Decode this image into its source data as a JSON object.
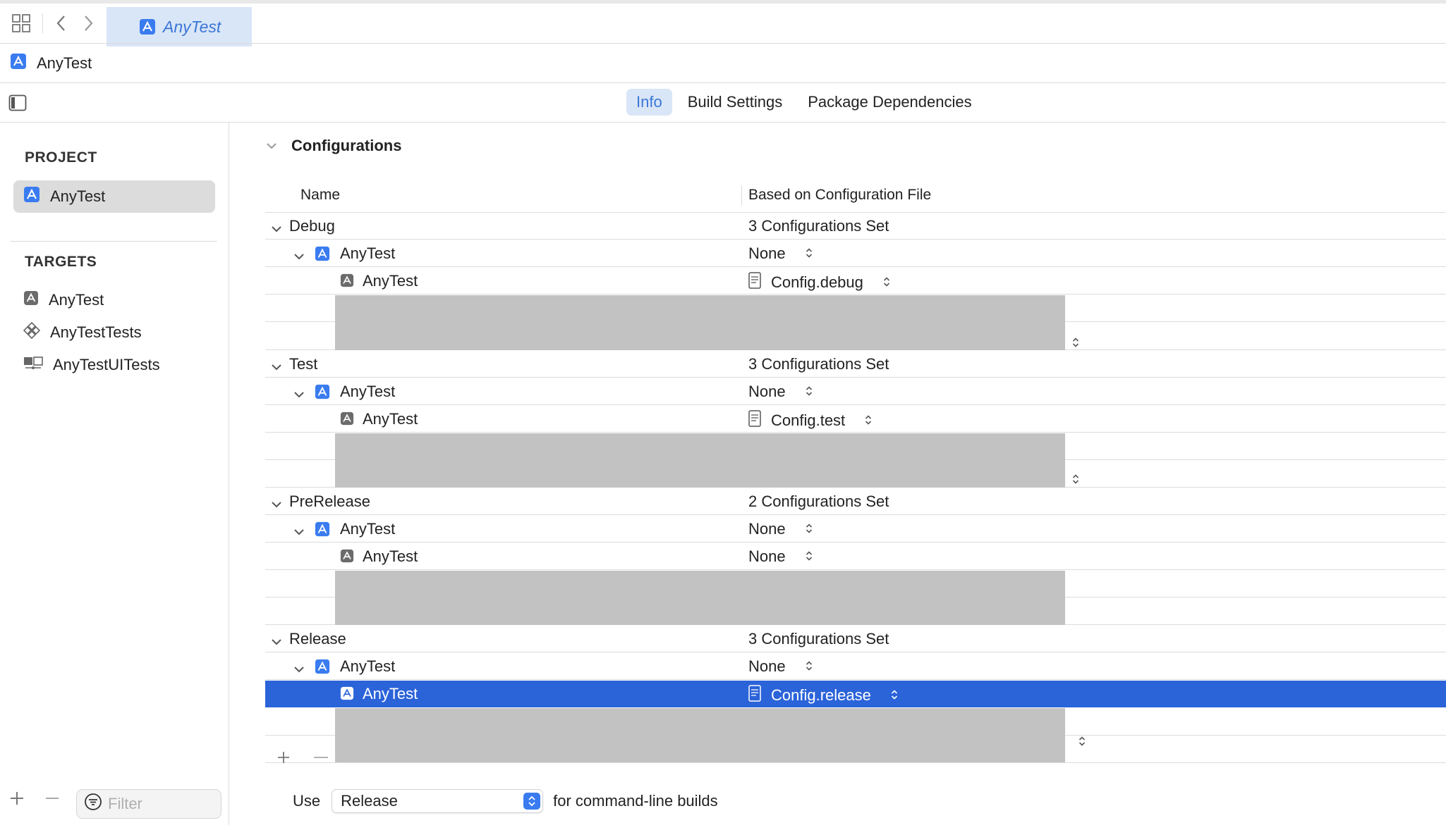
{
  "tab_bar": {
    "file_tab_label": "AnyTest",
    "icons": [
      "grid-icon",
      "back-chevron-icon",
      "forward-chevron-icon",
      "app-icon"
    ]
  },
  "jump_bar": {
    "project_label": "AnyTest"
  },
  "editor_tabs": {
    "items": [
      "Info",
      "Build Settings",
      "Package Dependencies"
    ],
    "active": "Info"
  },
  "sidebar": {
    "project_header": "PROJECT",
    "project_item": "AnyTest",
    "targets_header": "TARGETS",
    "targets": [
      "AnyTest",
      "AnyTestTests",
      "AnyTestUITests"
    ],
    "filter_placeholder": "Filter"
  },
  "configurations": {
    "title": "Configurations",
    "columns": {
      "name": "Name",
      "based_on": "Based on Configuration File"
    },
    "groups": [
      {
        "name": "Debug",
        "summary": "3 Configurations Set",
        "project": {
          "name": "AnyTest",
          "file": "None"
        },
        "target": {
          "name": "AnyTest",
          "file": "Config.debug"
        }
      },
      {
        "name": "Test",
        "summary": "3 Configurations Set",
        "project": {
          "name": "AnyTest",
          "file": "None"
        },
        "target": {
          "name": "AnyTest",
          "file": "Config.test"
        }
      },
      {
        "name": "PreRelease",
        "summary": "2 Configurations Set",
        "project": {
          "name": "AnyTest",
          "file": "None"
        },
        "target": {
          "name": "AnyTest",
          "file": "None"
        }
      },
      {
        "name": "Release",
        "summary": "3 Configurations Set",
        "project": {
          "name": "AnyTest",
          "file": "None"
        },
        "target": {
          "name": "AnyTest",
          "file": "Config.release"
        }
      }
    ]
  },
  "command_line": {
    "prefix": "Use",
    "selected": "Release",
    "suffix": "for command-line builds"
  },
  "colors": {
    "accent": "#3a76d8",
    "selection": "#2b63d9",
    "tab_highlight": "#d9e6f7",
    "blank_area": "#c2c2c2"
  }
}
